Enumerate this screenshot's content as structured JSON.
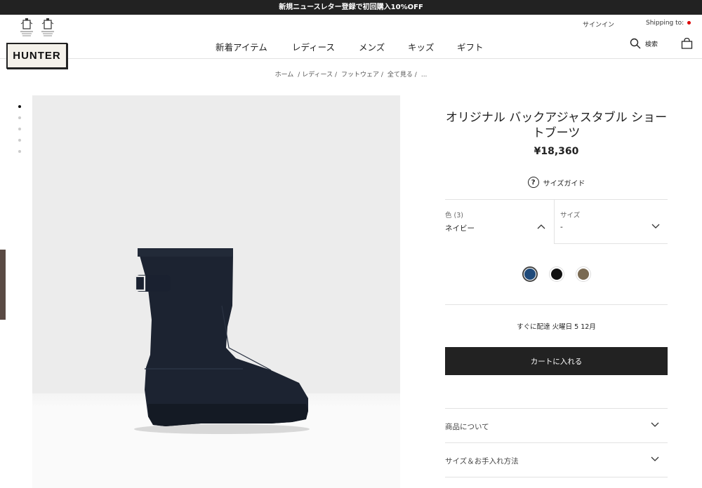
{
  "promo": {
    "text": "新規ニュースレター登録で初回購入10%OFF"
  },
  "header": {
    "logo": "HUNTER",
    "signin": "サインイン",
    "shipping": "Shipping to:",
    "search_label": "検索",
    "nav": [
      "新着アイテム",
      "レディース",
      "メンズ",
      "キッズ",
      "ギフト"
    ]
  },
  "breadcrumb": [
    "ホーム",
    "/ レディース /",
    "フットウェア /",
    "全て見る /",
    "..."
  ],
  "product": {
    "title": "オリジナル バックアジャスタブル ショートブーツ",
    "price": "¥18,360",
    "size_guide": "サイズガイド",
    "color_label": "色 (3)",
    "color_value": "ネイビー",
    "size_label": "サイズ",
    "size_value": "-",
    "swatches": [
      {
        "name": "navy",
        "color": "#1f4a7a"
      },
      {
        "name": "black",
        "color": "#111111"
      },
      {
        "name": "brown",
        "color": "#7a6a52"
      }
    ],
    "delivery": "すぐに配達 火曜日 5 12月",
    "add_to_cart": "カートに入れる"
  },
  "accordions": [
    "商品について",
    "サイズ＆お手入れ方法"
  ],
  "colors": {
    "dark": "#222222",
    "boot": "#1c2331",
    "flag": "#dd0000"
  }
}
